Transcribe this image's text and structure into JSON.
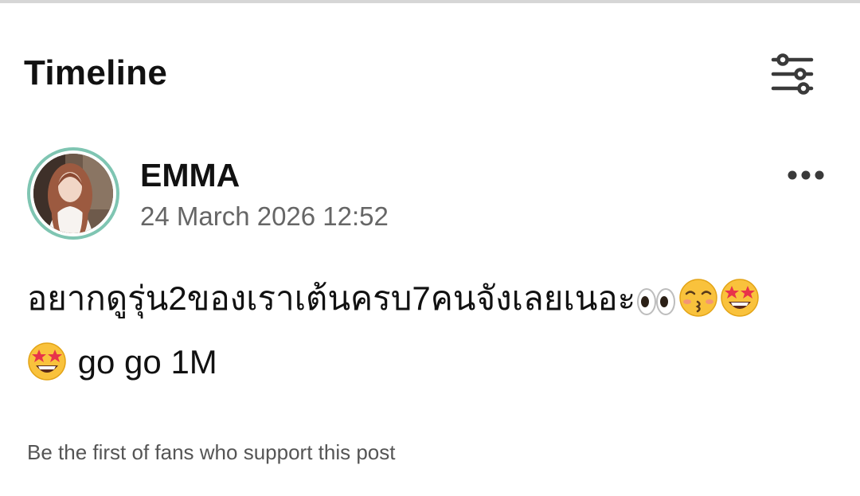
{
  "header": {
    "title": "Timeline",
    "filter_icon": "sliders-icon"
  },
  "post": {
    "author": "EMMA",
    "timestamp": "24 March 2026 12:52",
    "more_icon": "more-horizontal-icon",
    "body_text_line1": "อยากดูรุ่น2ของเราเต้นครบ7คนจังเลยเนอะ",
    "body_text_line2": " go go 1M",
    "emojis": [
      "eyes-emoji",
      "kissing-face-emoji",
      "star-struck-emoji",
      "star-struck-emoji"
    ],
    "support_text": "Be the first of fans who support this post"
  },
  "colors": {
    "avatar_ring": "#7fc5b2",
    "timestamp": "#666666",
    "divider": "#d6d6d6"
  }
}
